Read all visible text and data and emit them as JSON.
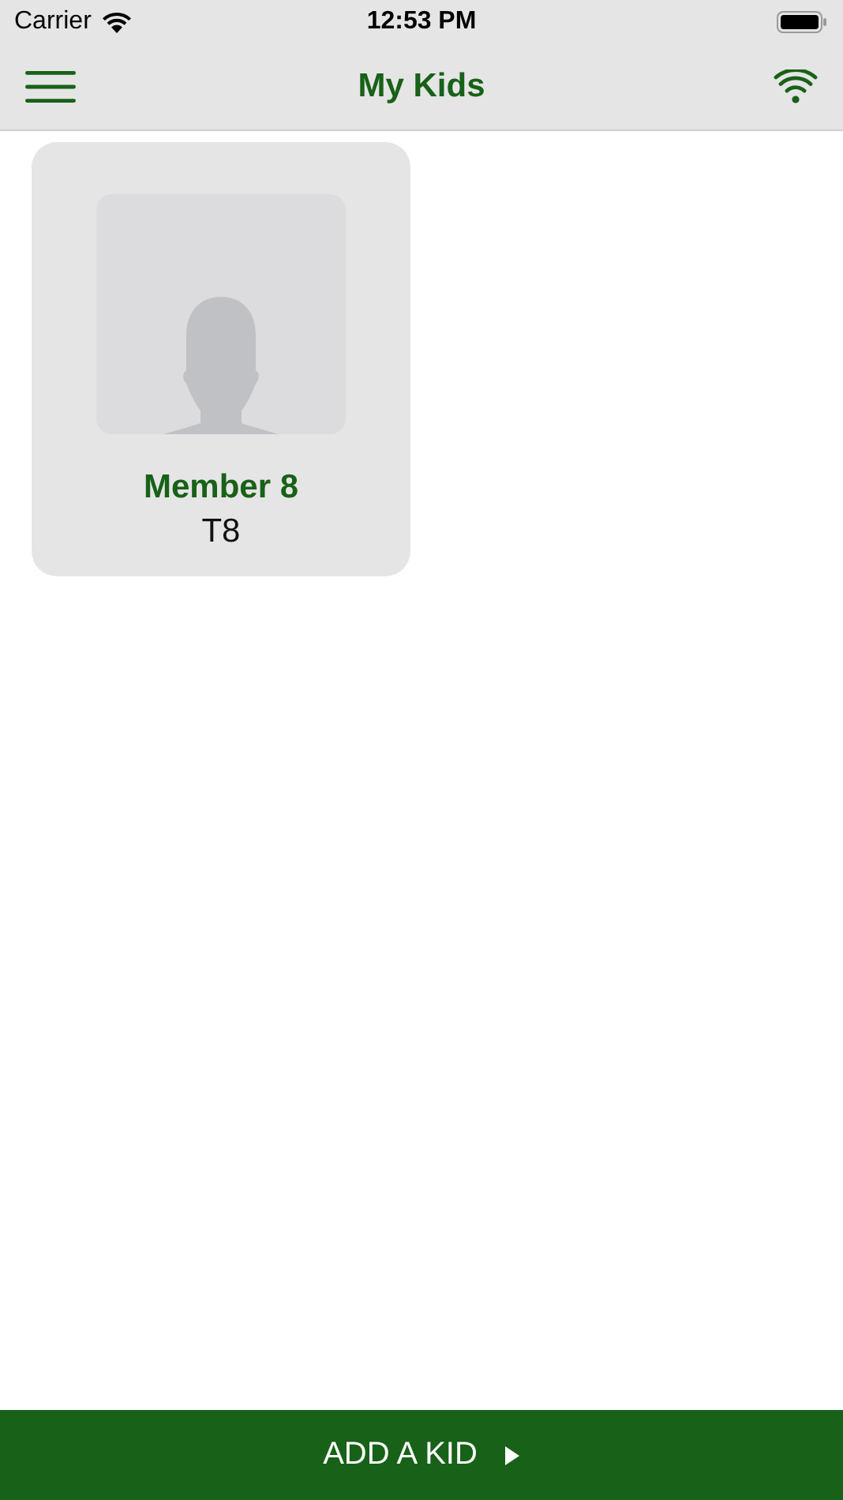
{
  "status_bar": {
    "carrier": "Carrier",
    "time": "12:53 PM"
  },
  "nav_bar": {
    "title": "My Kids"
  },
  "kids": [
    {
      "name": "Member 8",
      "code": "T8"
    }
  ],
  "add_button": {
    "label": "ADD A KID"
  }
}
